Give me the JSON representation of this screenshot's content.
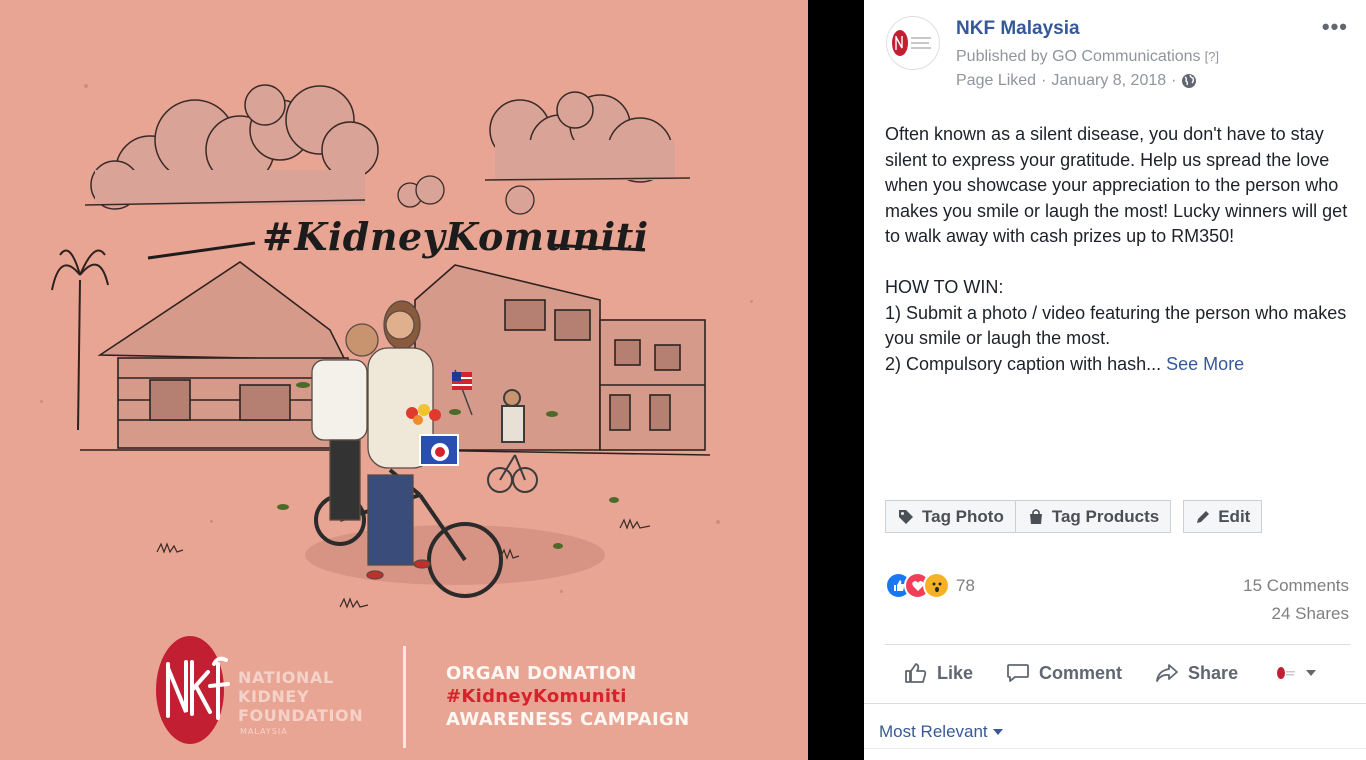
{
  "poster": {
    "hashtag": "#KidneyKomuniti",
    "logo_text": "NKF",
    "org_name_lines": [
      "NATIONAL",
      "KIDNEY",
      "FOUNDATION"
    ],
    "org_country": "MALAYSIA",
    "campaign_line1": "ORGAN DONATION",
    "campaign_line2": "#KidneyKomuniti",
    "campaign_line3": "AWARENESS CAMPAIGN",
    "colors": {
      "background": "#e9a594",
      "brand_red": "#d6222b"
    }
  },
  "post": {
    "page_name": "NKF Malaysia",
    "published_by": "Published by GO Communications",
    "published_help": "[?]",
    "page_liked": "Page Liked",
    "separator": "·",
    "date": "January 8, 2018",
    "privacy_icon": "globe-icon",
    "more_icon": "•••",
    "text": "Often known as a silent disease, you don't have to stay silent to express your gratitude. Help us spread the love when you showcase your appreciation to the person who makes you smile or laugh the most! Lucky winners will get to walk away with cash prizes up to RM350!\n\nHOW TO WIN:\n1) Submit a photo / video featuring the person who makes you smile or laugh the most.\n2) Compulsory caption with hash...",
    "see_more": "See More"
  },
  "photo_actions": {
    "tag_photo": "Tag Photo",
    "tag_products": "Tag Products",
    "edit": "Edit"
  },
  "stats": {
    "reactions": [
      "like",
      "love",
      "wow"
    ],
    "reaction_count": "78",
    "comments": "15 Comments",
    "shares": "24 Shares"
  },
  "bottom_actions": {
    "like": "Like",
    "comment": "Comment",
    "share": "Share"
  },
  "comments_filter": "Most Relevant",
  "colors": {
    "link": "#365899",
    "muted": "#90949c",
    "like_blue": "#1877f2",
    "love_red": "#f33e58",
    "wow_yellow": "#f7b125"
  }
}
